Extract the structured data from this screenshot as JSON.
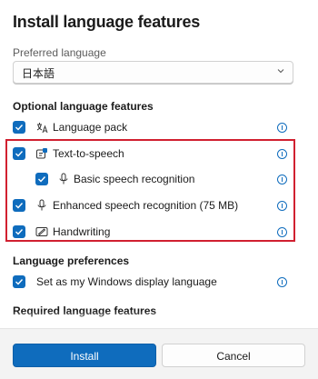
{
  "dialog": {
    "title": "Install language features"
  },
  "preferred_language": {
    "label": "Preferred language",
    "value": "日本語"
  },
  "optional_features": {
    "heading": "Optional language features",
    "items": [
      {
        "label": "Language pack",
        "checked": true,
        "icon": "language-pack-icon"
      },
      {
        "label": "Text-to-speech",
        "checked": true,
        "icon": "text-to-speech-icon"
      },
      {
        "label": "Basic speech recognition",
        "checked": true,
        "icon": "microphone-icon"
      },
      {
        "label": "Enhanced speech recognition (75 MB)",
        "checked": true,
        "icon": "microphone-icon"
      },
      {
        "label": "Handwriting",
        "checked": true,
        "icon": "handwriting-icon"
      }
    ]
  },
  "language_preferences": {
    "heading": "Language preferences",
    "items": [
      {
        "label": "Set as my Windows display language",
        "checked": true
      }
    ]
  },
  "required_features": {
    "heading": "Required language features"
  },
  "buttons": {
    "install": "Install",
    "cancel": "Cancel"
  },
  "colors": {
    "accent": "#0f6cbd",
    "highlight_box": "#d12030"
  }
}
